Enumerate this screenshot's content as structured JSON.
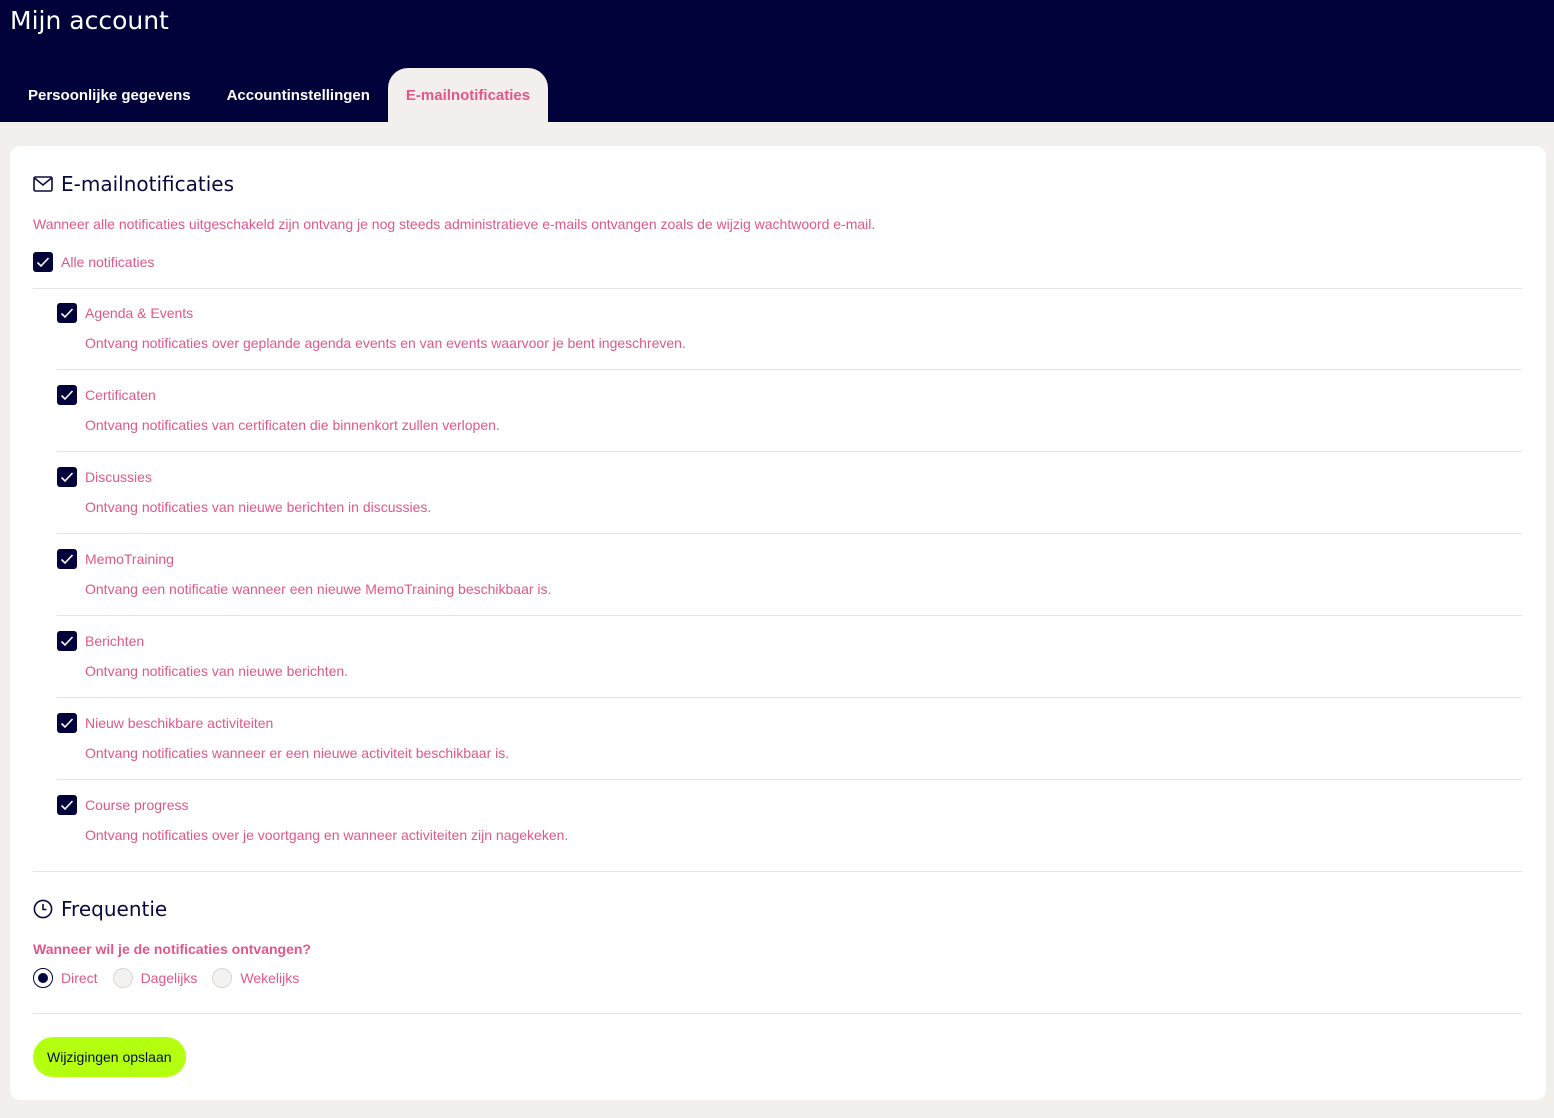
{
  "page": {
    "title": "Mijn account"
  },
  "tabs": [
    {
      "label": "Persoonlijke gegevens",
      "active": false
    },
    {
      "label": "Accountinstellingen",
      "active": false
    },
    {
      "label": "E-mailnotificaties",
      "active": true
    }
  ],
  "notifications": {
    "heading": "E-mailnotificaties",
    "heading_icon": "mail-icon",
    "info": "Wanneer alle notificaties uitgeschakeld zijn ontvang je nog steeds administratieve e-mails ontvangen zoals de wijzig wachtwoord e-mail.",
    "all_label": "Alle notificaties",
    "all_checked": true,
    "items": [
      {
        "label": "Agenda & Events",
        "description": "Ontvang notificaties over geplande agenda events en van events waarvoor je bent ingeschreven.",
        "checked": true
      },
      {
        "label": "Certificaten",
        "description": "Ontvang notificaties van certificaten die binnenkort zullen verlopen.",
        "checked": true
      },
      {
        "label": "Discussies",
        "description": "Ontvang notificaties van nieuwe berichten in discussies.",
        "checked": true
      },
      {
        "label": "MemoTraining",
        "description": "Ontvang een notificatie wanneer een nieuwe MemoTraining beschikbaar is.",
        "checked": true
      },
      {
        "label": "Berichten",
        "description": "Ontvang notificaties van nieuwe berichten.",
        "checked": true
      },
      {
        "label": "Nieuw beschikbare activiteiten",
        "description": "Ontvang notificaties wanneer er een nieuwe activiteit beschikbaar is.",
        "checked": true
      },
      {
        "label": "Course progress",
        "description": "Ontvang notificaties over je voortgang en wanneer activiteiten zijn nagekeken.",
        "checked": true
      }
    ]
  },
  "frequency": {
    "heading": "Frequentie",
    "heading_icon": "clock-icon",
    "question": "Wanneer wil je de notificaties ontvangen?",
    "options": [
      {
        "label": "Direct",
        "selected": true
      },
      {
        "label": "Dagelijks",
        "selected": false
      },
      {
        "label": "Wekelijks",
        "selected": false
      }
    ]
  },
  "actions": {
    "save_label": "Wijzigingen opslaan"
  },
  "colors": {
    "navy": "#02023a",
    "pink": "#e0578a",
    "lime": "#b3ff0f",
    "background": "#f3efec"
  }
}
